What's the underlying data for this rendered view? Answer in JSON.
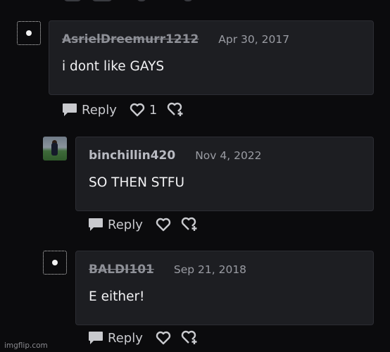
{
  "comments": [
    {
      "username": "AsrielDreemurr1212",
      "username_deleted": true,
      "date": "Apr 30, 2017",
      "text": "i dont like GAYS",
      "reply_label": "Reply",
      "like_count": "1",
      "avatar": "placeholder-icon"
    },
    {
      "username": "binchillin420",
      "username_deleted": false,
      "date": "Nov 4, 2022",
      "text": "SO THEN STFU",
      "reply_label": "Reply",
      "like_count": "",
      "avatar": "photo-avatar"
    },
    {
      "username": "BALDI101",
      "username_deleted": true,
      "date": "Sep 21, 2018",
      "text": "E either!",
      "reply_label": "Reply",
      "like_count": "",
      "avatar": "placeholder-icon"
    }
  ],
  "watermark": "imgflip.com",
  "colors": {
    "background": "#0b0b0d",
    "card": "#1d1e22",
    "text": "#f2f2f4",
    "muted": "#9a9ca3"
  }
}
